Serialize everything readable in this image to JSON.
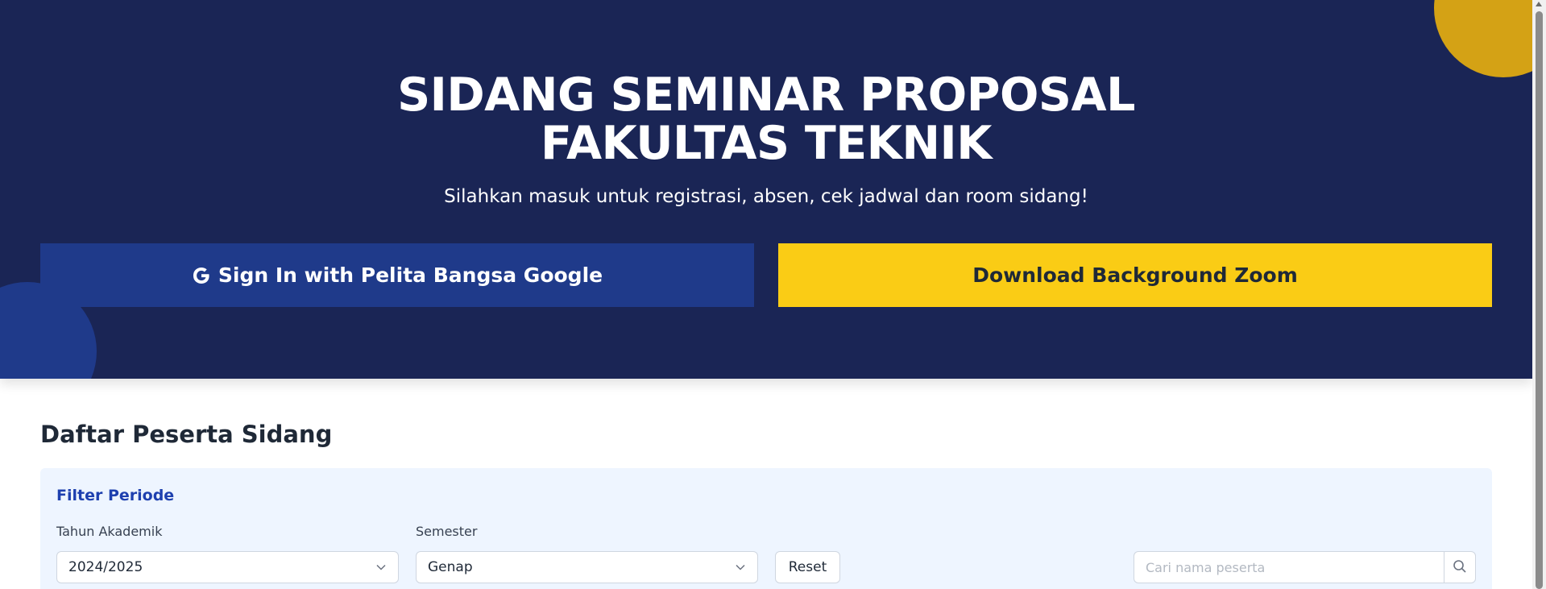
{
  "hero": {
    "title_line1": "SIDANG SEMINAR PROPOSAL",
    "title_line2": "FAKULTAS TEKNIK",
    "subtitle": "Silahkan masuk untuk registrasi, absen, cek jadwal dan room sidang!",
    "signin_label": "Sign In with Pelita Bangsa Google",
    "download_label": "Download Background Zoom"
  },
  "section": {
    "title": "Daftar Peserta Sidang"
  },
  "filter": {
    "title": "Filter Periode",
    "tahun_label": "Tahun Akademik",
    "tahun_value": "2024/2025",
    "semester_label": "Semester",
    "semester_value": "Genap",
    "reset_label": "Reset",
    "search_placeholder": "Cari nama peserta"
  },
  "colors": {
    "hero_bg": "#1a2555",
    "signin_bg": "#1f3a8a",
    "download_bg": "#facc15",
    "accent_circle": "#d4a215",
    "filter_bg": "#eef5ff"
  },
  "icons": {
    "signin": "google-icon",
    "select": "chevron-down-icon",
    "search": "search-icon"
  }
}
